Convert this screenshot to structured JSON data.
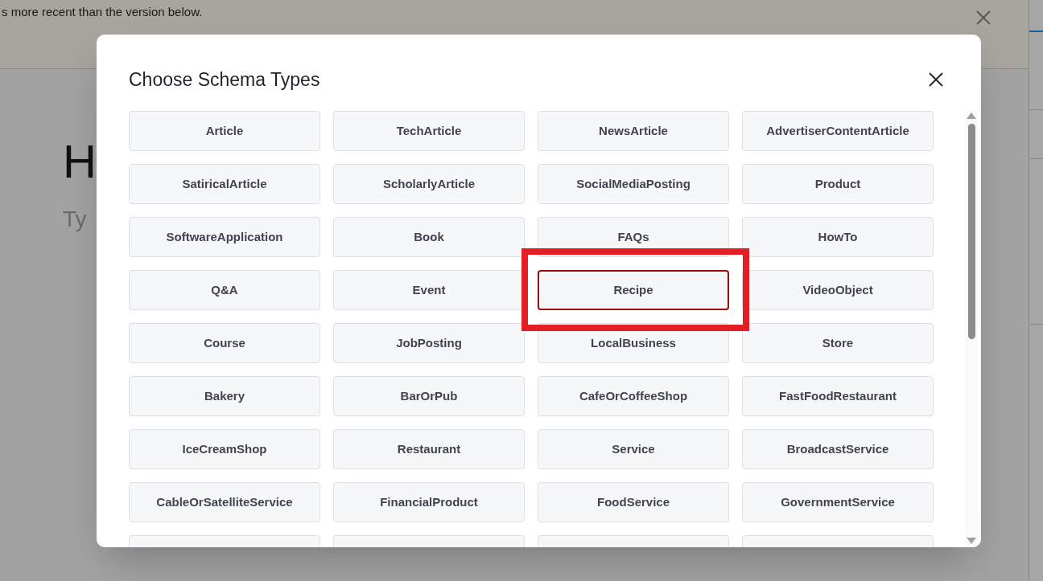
{
  "banner": {
    "text": "s more recent than the version below."
  },
  "page": {
    "heading": "H",
    "subheading": "Ty"
  },
  "modal": {
    "title": "Choose Schema Types",
    "types": [
      {
        "label": "Article",
        "selected": false
      },
      {
        "label": "TechArticle",
        "selected": false
      },
      {
        "label": "NewsArticle",
        "selected": false
      },
      {
        "label": "AdvertiserContentArticle",
        "selected": false
      },
      {
        "label": "SatiricalArticle",
        "selected": false
      },
      {
        "label": "ScholarlyArticle",
        "selected": false
      },
      {
        "label": "SocialMediaPosting",
        "selected": false
      },
      {
        "label": "Product",
        "selected": false
      },
      {
        "label": "SoftwareApplication",
        "selected": false
      },
      {
        "label": "Book",
        "selected": false
      },
      {
        "label": "FAQs",
        "selected": false
      },
      {
        "label": "HowTo",
        "selected": false
      },
      {
        "label": "Q&A",
        "selected": false
      },
      {
        "label": "Event",
        "selected": false
      },
      {
        "label": "Recipe",
        "selected": true
      },
      {
        "label": "VideoObject",
        "selected": false
      },
      {
        "label": "Course",
        "selected": false
      },
      {
        "label": "JobPosting",
        "selected": false
      },
      {
        "label": "LocalBusiness",
        "selected": false
      },
      {
        "label": "Store",
        "selected": false
      },
      {
        "label": "Bakery",
        "selected": false
      },
      {
        "label": "BarOrPub",
        "selected": false
      },
      {
        "label": "CafeOrCoffeeShop",
        "selected": false
      },
      {
        "label": "FastFoodRestaurant",
        "selected": false
      },
      {
        "label": "IceCreamShop",
        "selected": false
      },
      {
        "label": "Restaurant",
        "selected": false
      },
      {
        "label": "Service",
        "selected": false
      },
      {
        "label": "BroadcastService",
        "selected": false
      },
      {
        "label": "CableOrSatelliteService",
        "selected": false
      },
      {
        "label": "FinancialProduct",
        "selected": false
      },
      {
        "label": "FoodService",
        "selected": false
      },
      {
        "label": "GovernmentService",
        "selected": false
      }
    ]
  }
}
